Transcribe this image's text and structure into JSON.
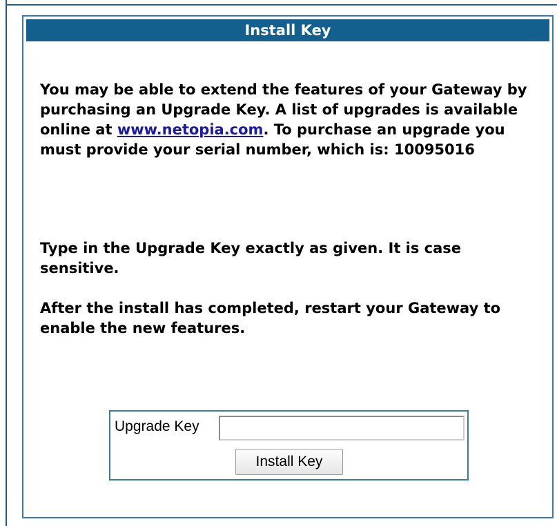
{
  "header": {
    "title": "Install Key"
  },
  "intro": {
    "text_before_link": "You may be able to extend the features of your Gateway by purchasing an Upgrade Key. A list of upgrades is available online at ",
    "link_text": "www.netopia.com",
    "text_after_link": ". To purchase an upgrade you must provide your serial number, which is: ",
    "serial_number": "10095016"
  },
  "instructions": {
    "case_note": "Type in the Upgrade Key exactly as given. It is case sensitive.",
    "restart_note": "After the install has completed, restart your Gateway to enable the new features."
  },
  "form": {
    "key_label": "Upgrade Key",
    "key_value": "",
    "install_button_label": "Install Key"
  },
  "colors": {
    "header_background": "#13608e",
    "border": "#3a7aa6",
    "link": "#1a1aa6"
  }
}
